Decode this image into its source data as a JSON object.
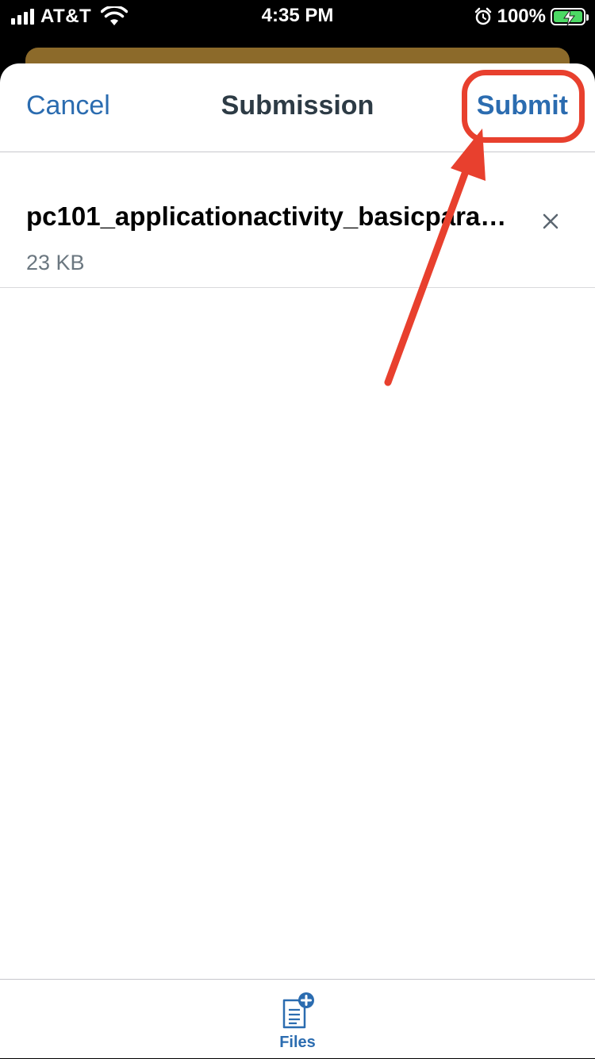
{
  "status_bar": {
    "carrier": "AT&T",
    "time": "4:35 PM",
    "battery": "100%"
  },
  "nav": {
    "cancel_label": "Cancel",
    "title": "Submission",
    "submit_label": "Submit"
  },
  "files": [
    {
      "name": "pc101_applicationactivity_basicparagr...",
      "size": "23 KB"
    }
  ],
  "tab_bar": {
    "files_label": "Files"
  },
  "colors": {
    "accent": "#2b6cb0",
    "annotation": "#e8402e",
    "title": "#2d3b45",
    "behind_card": "#8c6a2a"
  },
  "icons": [
    "signal-icon",
    "wifi-icon",
    "alarm-icon",
    "battery-icon",
    "close-icon",
    "files-add-icon",
    "annotation-arrow"
  ]
}
